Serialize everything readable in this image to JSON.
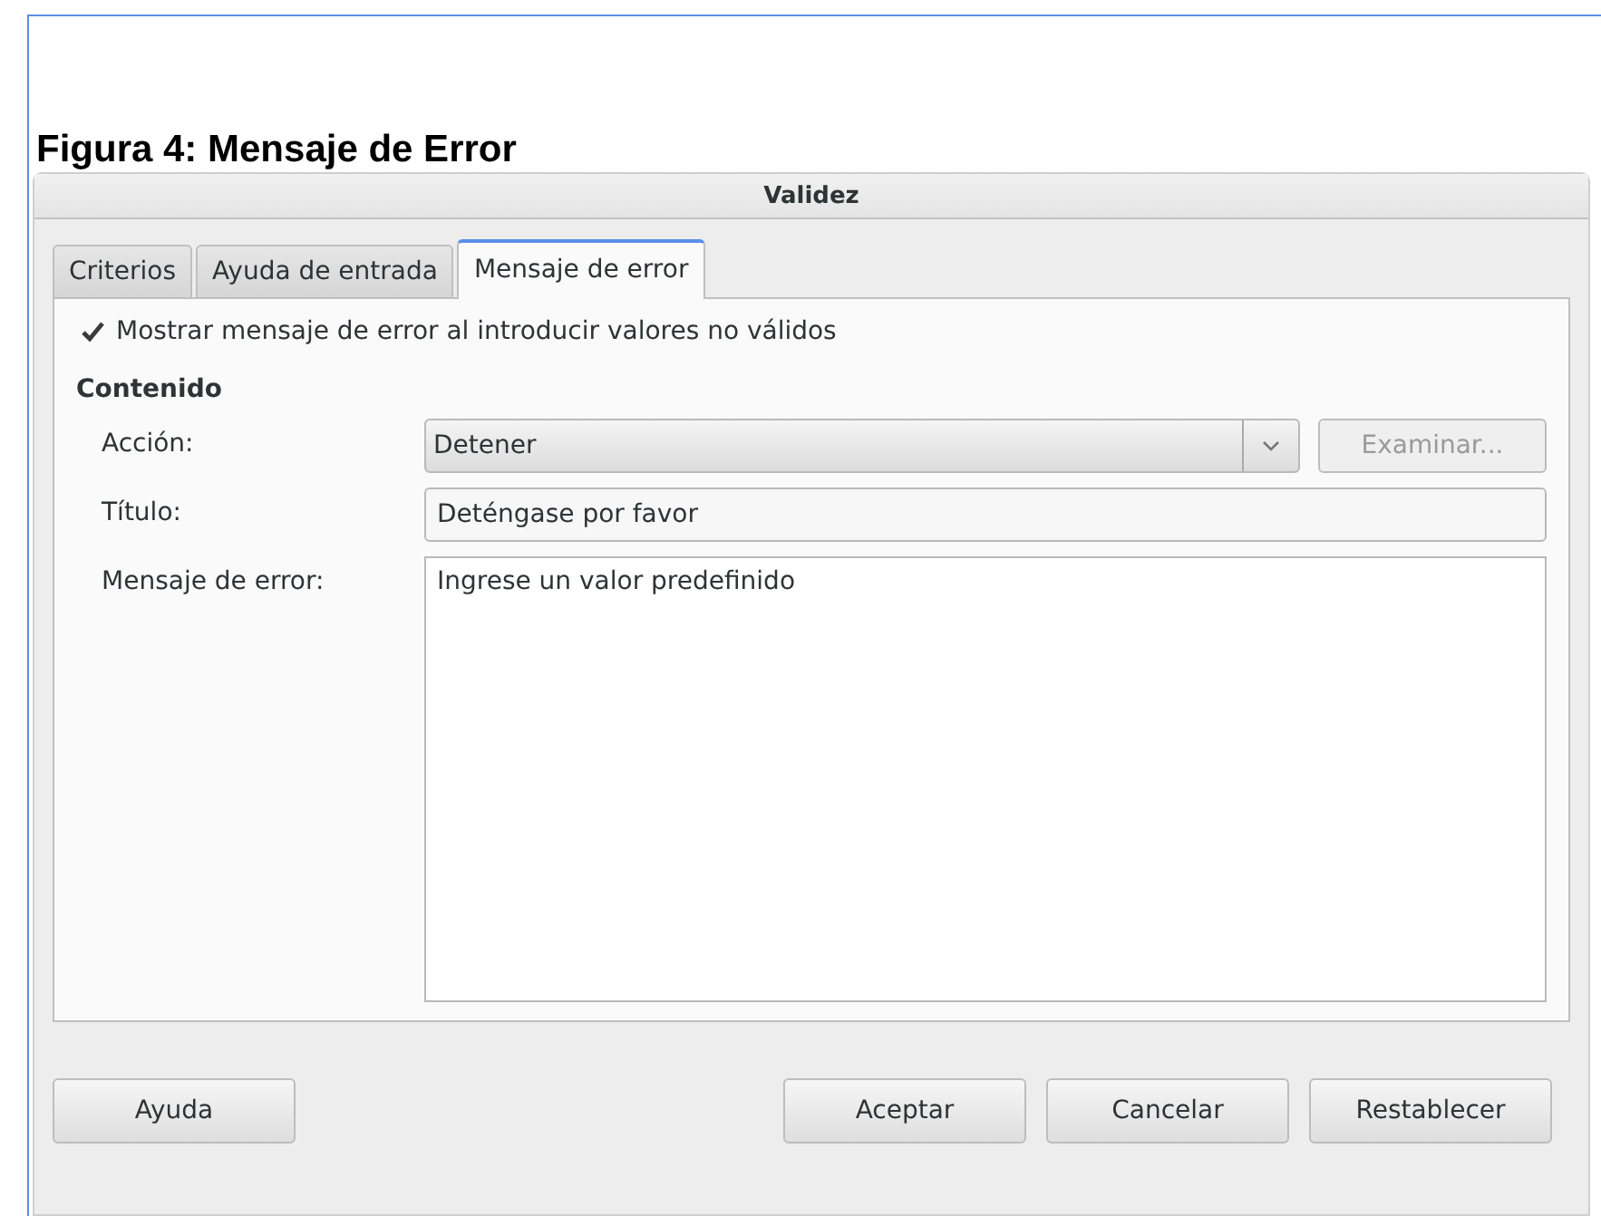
{
  "caption": "Figura 4: Mensaje de Error",
  "window": {
    "title": "Validez"
  },
  "tabs": [
    {
      "label": "Criterios",
      "selected": false
    },
    {
      "label": "Ayuda de entrada",
      "selected": false
    },
    {
      "label": "Mensaje de error",
      "selected": true
    }
  ],
  "show_error": {
    "label": "Mostrar mensaje de error al introducir valores no válidos",
    "checked": true
  },
  "section": "Contenido",
  "action": {
    "label": "Acción:",
    "value": "Detener",
    "browse": {
      "label": "Examinar...",
      "disabled": true
    }
  },
  "title_field": {
    "label": "Título:",
    "value": "Deténgase por favor"
  },
  "message_field": {
    "label": "Mensaje de error:",
    "value": "Ingrese un valor predefinido"
  },
  "buttons_left": [
    "Ayuda"
  ],
  "buttons_right": [
    "Aceptar",
    "Cancelar",
    "Restablecer"
  ]
}
